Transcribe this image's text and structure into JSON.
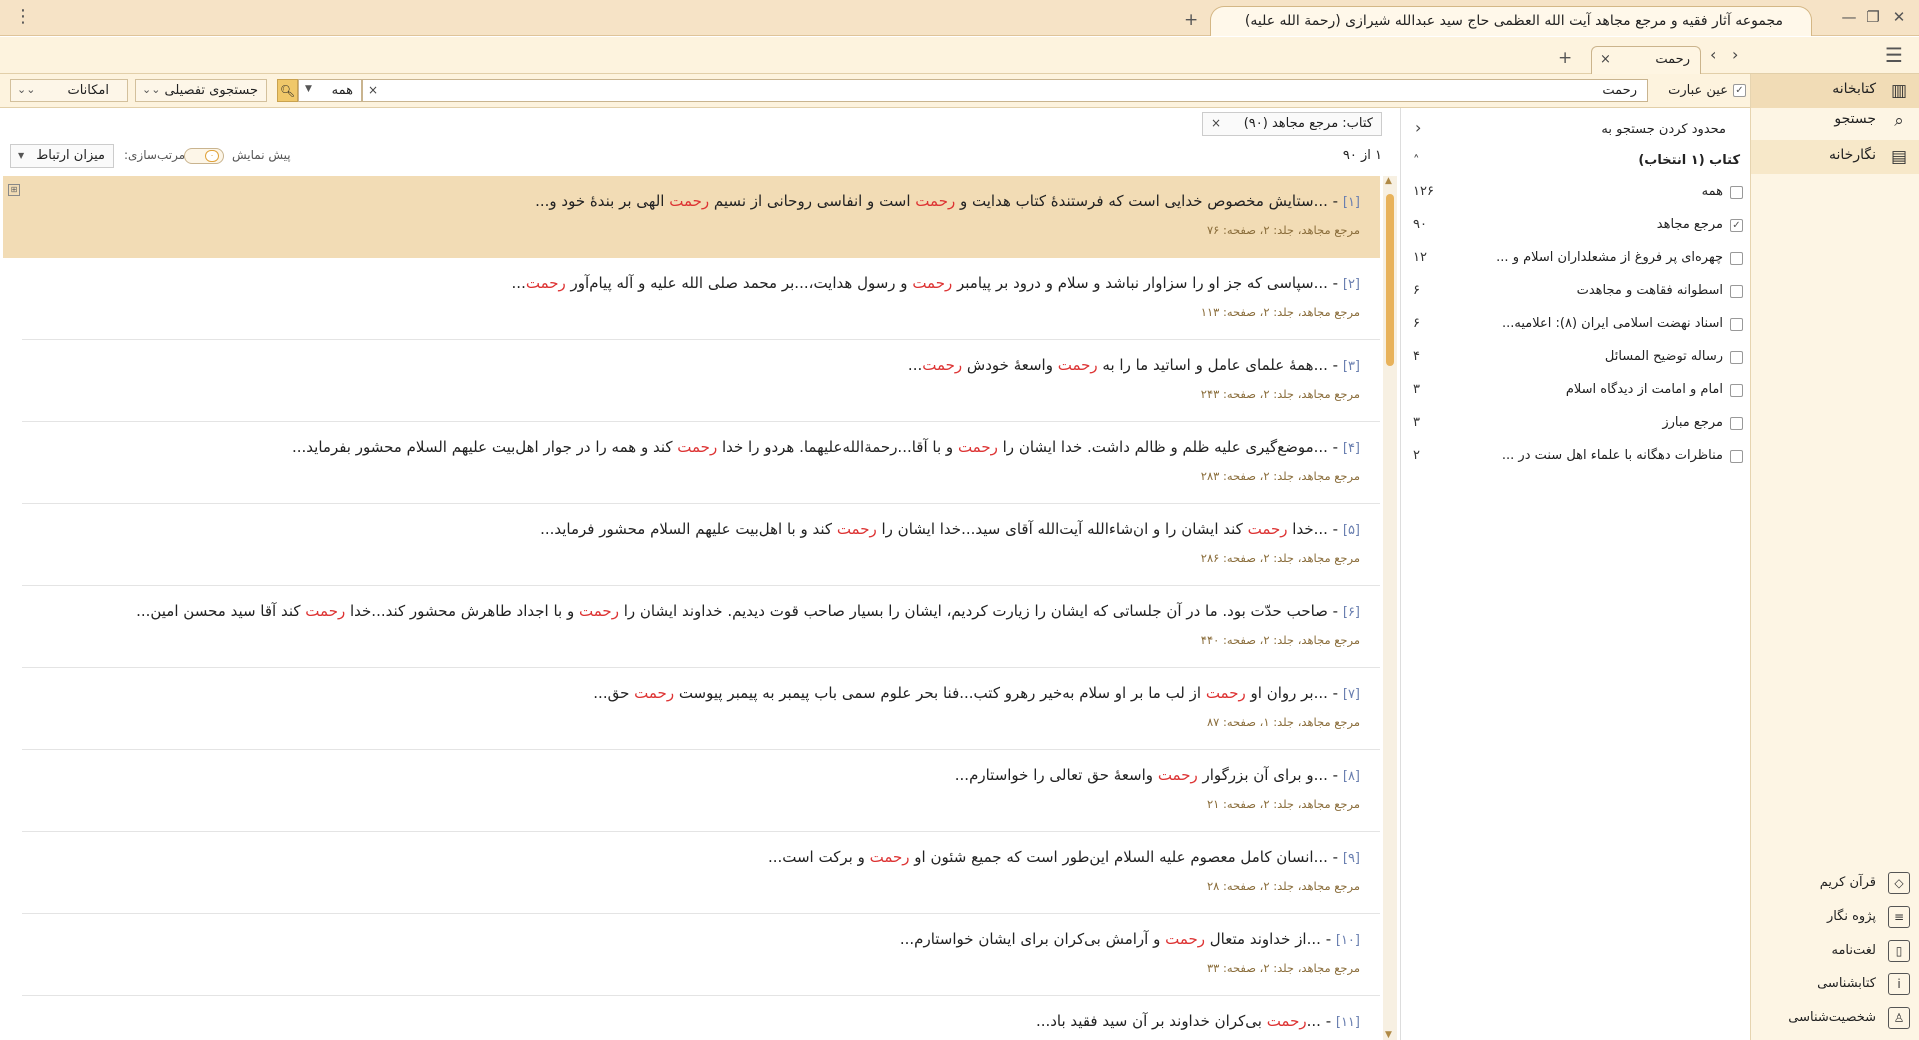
{
  "window": {
    "title": "مجموعه آثار فقیه و مرجع مجاهد آیت الله العظمی حاج سید عبدالله شیرازی (رحمة الله علیه)",
    "menu_dots": "⋮",
    "minimize": "—",
    "restore": "❐",
    "close": "✕",
    "new_tab": "+"
  },
  "tabs": {
    "menu": "☰",
    "back": "‹",
    "forward": "›",
    "current": "رحمت",
    "close": "×",
    "add": "+"
  },
  "sidebar": {
    "items": [
      {
        "label": "کتابخانه",
        "icon": "library-icon",
        "glyph": "▥"
      },
      {
        "label": "جستجو",
        "icon": "search-icon",
        "glyph": "⌕"
      },
      {
        "label": "نگارخانه",
        "icon": "gallery-icon",
        "glyph": "▤"
      }
    ],
    "bottom": [
      {
        "label": "قرآن کریم",
        "icon": "quran-icon",
        "glyph": "◇"
      },
      {
        "label": "پژوه نگار",
        "icon": "notes-icon",
        "glyph": "≡"
      },
      {
        "label": "لغت‌نامه",
        "icon": "dictionary-icon",
        "glyph": "▯"
      },
      {
        "label": "کتابشناسی",
        "icon": "bibliography-icon",
        "glyph": "i"
      },
      {
        "label": "شخصیت‌شناسی",
        "icon": "person-icon",
        "glyph": "♙"
      }
    ]
  },
  "search": {
    "exact_label": "عین عبارت",
    "exact_checked": true,
    "query": "رحمت",
    "clear": "×",
    "scope": "همه",
    "advanced": "جستجوی تفصیلی",
    "options": "امکانات"
  },
  "filter": {
    "collapse": "›",
    "heading": "محدود کردن جستجو به",
    "section": "کتاب (۱ انتخاب)",
    "section_arrow": "˄",
    "rows": [
      {
        "label": "همه",
        "count": "۱۲۶",
        "checked": false
      },
      {
        "label": "مرجع مجاهد",
        "count": "۹۰",
        "checked": true
      },
      {
        "label": "چهره‌ای پر فروغ از مشعلداران اسلام و ...",
        "count": "۱۲",
        "checked": false
      },
      {
        "label": "اسطوانه فقاهت و مجاهدت",
        "count": "۶",
        "checked": false
      },
      {
        "label": "اسناد نهضت اسلامی ایران (۸): اعلامیه...",
        "count": "۶",
        "checked": false
      },
      {
        "label": "رساله توضیح المسائل",
        "count": "۴",
        "checked": false
      },
      {
        "label": "امام و امامت از دیدگاه اسلام",
        "count": "۳",
        "checked": false
      },
      {
        "label": "مرجع مبارز",
        "count": "۳",
        "checked": false
      },
      {
        "label": "مناظرات دهگانه با علماء اهل سنت در ...",
        "count": "۲",
        "checked": false
      }
    ]
  },
  "results": {
    "chip": "کتاب: مرجع مجاهد (۹۰)",
    "chip_close": "×",
    "count": "۱ از ۹۰",
    "preview_label": "پیش نمایش",
    "preview_value": "۰",
    "sort_label": "مرتب‌سازی:",
    "sort_value": "میزان ارتباط",
    "items": [
      {
        "num": "[۱]",
        "parts": [
          "...ستایش مخصوص خدایی است که فرستندهٔ کتاب هدایت و ",
          "رحمت",
          " است و انفاسی روحانی از نسیم ",
          "رحمت",
          " الهی بر بندهٔ خود و..."
        ],
        "ref": "مرجع مجاهد، جلد: ۲، صفحه: ۷۶"
      },
      {
        "num": "[۲]",
        "parts": [
          "...سپاسی که جز او را سزاوار نباشد و سلام و درود بر پیامبر ",
          "رحمت",
          " و رسول هدایت،...بر محمد صلی الله علیه و آله پیام‌آور ",
          "رحمت",
          "..."
        ],
        "ref": "مرجع مجاهد، جلد: ۲، صفحه: ۱۱۳"
      },
      {
        "num": "[۳]",
        "parts": [
          "...همهٔ علمای عامل و اساتید ما را به ",
          "رحمت",
          " واسعهٔ خودش ",
          "رحمت",
          "..."
        ],
        "ref": "مرجع مجاهد، جلد: ۲، صفحه: ۲۴۳"
      },
      {
        "num": "[۴]",
        "parts": [
          "...موضع‌گیری علیه ظلم و ظالم داشت. خدا ایشان را ",
          "رحمت",
          " و با آقا...رحمة‌الله‌علیهما. هردو را خدا ",
          "رحمت",
          " کند و همه را در جوار اهل‌بیت علیهم السلام محشور بفرماید..."
        ],
        "ref": "مرجع مجاهد، جلد: ۲، صفحه: ۲۸۳"
      },
      {
        "num": "[۵]",
        "parts": [
          "...خدا ",
          "رحمت",
          " کند ایشان را و ان‌شاءالله آیت‌الله آقای سید...خدا ایشان را ",
          "رحمت",
          " کند و با اهل‌بیت علیهم السلام محشور فرماید..."
        ],
        "ref": "مرجع مجاهد، جلد: ۲، صفحه: ۲۸۶"
      },
      {
        "num": "[۶]",
        "parts": [
          "صاحب حدّت بود. ما در آن جلساتی که ایشان را زیارت کردیم، ایشان را بسیار صاحب قوت دیدیم. خداوند ایشان را ",
          "رحمت",
          " و با اجداد طاهرش محشور کند...خدا ",
          "رحمت",
          " کند آقا سید محسن امین..."
        ],
        "ref": "مرجع مجاهد، جلد: ۲، صفحه: ۴۴۰"
      },
      {
        "num": "[۷]",
        "parts": [
          "...بر روان او ",
          "رحمت",
          " از لب ما بر او سلام به‌خیر رهرو کتب...فنا بحر علوم سمی باب پیمبر به پیمبر پیوست ",
          "رحمت",
          " حق..."
        ],
        "ref": "مرجع مجاهد، جلد: ۱، صفحه: ۸۷"
      },
      {
        "num": "[۸]",
        "parts": [
          "...و برای آن بزرگوار ",
          "رحمت",
          " واسعهٔ حق تعالی را خواستارم..."
        ],
        "ref": "مرجع مجاهد، جلد: ۲، صفحه: ۲۱"
      },
      {
        "num": "[۹]",
        "parts": [
          "...انسان کامل معصوم علیه السلام این‌طور است که جمیع شئون او ",
          "رحمت",
          " و برکت است..."
        ],
        "ref": "مرجع مجاهد، جلد: ۲، صفحه: ۲۸"
      },
      {
        "num": "[۱۰]",
        "parts": [
          "...از خداوند متعال ",
          "رحمت",
          " و آرامش بی‌کران برای ایشان خواستارم..."
        ],
        "ref": "مرجع مجاهد، جلد: ۲، صفحه: ۳۳"
      },
      {
        "num": "[۱۱]",
        "parts": [
          "...",
          "رحمت",
          " بی‌کران خداوند بر آن سید فقید باد..."
        ],
        "ref": ""
      }
    ]
  },
  "colors": {
    "highlight": "#dd3333",
    "accent": "#f0c86a",
    "selected_row": "#f2dcb5"
  }
}
